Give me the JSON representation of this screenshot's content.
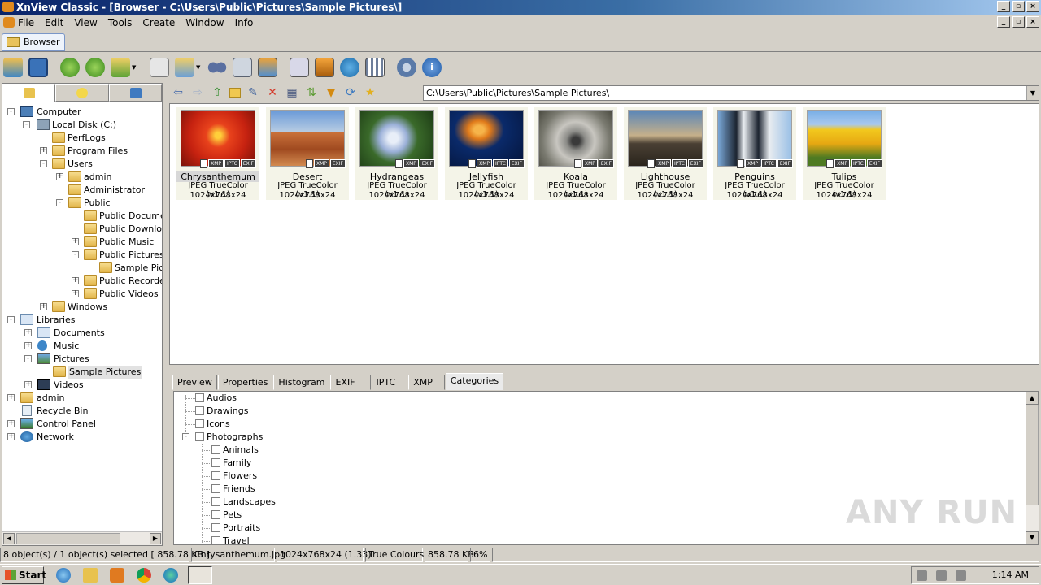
{
  "window": {
    "title": "XnView Classic - [Browser - C:\\Users\\Public\\Pictures\\Sample Pictures\\]"
  },
  "menu": [
    "File",
    "Edit",
    "View",
    "Tools",
    "Create",
    "Window",
    "Info"
  ],
  "doc_tab": "Browser",
  "address": "C:\\Users\\Public\\Pictures\\Sample Pictures\\",
  "tree": [
    {
      "label": "Computer",
      "icon": "computer-icon"
    },
    {
      "label": "Local Disk (C:)",
      "icon": "drive-icon"
    },
    {
      "label": "PerfLogs",
      "icon": "folder-icon"
    },
    {
      "label": "Program Files",
      "icon": "folder-icon"
    },
    {
      "label": "Users",
      "icon": "folder-icon"
    },
    {
      "label": "admin",
      "icon": "folder-icon"
    },
    {
      "label": "Administrator",
      "icon": "folder-icon"
    },
    {
      "label": "Public",
      "icon": "folder-icon"
    },
    {
      "label": "Public Documen",
      "icon": "folder-icon"
    },
    {
      "label": "Public Downloac",
      "icon": "folder-icon"
    },
    {
      "label": "Public Music",
      "icon": "folder-icon"
    },
    {
      "label": "Public Pictures",
      "icon": "folder-icon"
    },
    {
      "label": "Sample Pictu",
      "icon": "folder-icon"
    },
    {
      "label": "Public Recorded",
      "icon": "folder-icon"
    },
    {
      "label": "Public Videos",
      "icon": "folder-icon"
    },
    {
      "label": "Windows",
      "icon": "folder-icon"
    },
    {
      "label": "Libraries",
      "icon": "libraries-icon"
    },
    {
      "label": "Documents",
      "icon": "documents-icon"
    },
    {
      "label": "Music",
      "icon": "music-icon"
    },
    {
      "label": "Pictures",
      "icon": "pictures-icon"
    },
    {
      "label": "Sample Pictures",
      "icon": "folder-icon"
    },
    {
      "label": "Videos",
      "icon": "videos-icon"
    },
    {
      "label": "admin",
      "icon": "user-folder-icon"
    },
    {
      "label": "Recycle Bin",
      "icon": "recycle-bin-icon"
    },
    {
      "label": "Control Panel",
      "icon": "control-panel-icon"
    },
    {
      "label": "Network",
      "icon": "network-icon"
    }
  ],
  "thumbnails": [
    {
      "name": "Chrysanthemum",
      "format": "JPEG TrueColor (v1.1)",
      "dims": "1024x768x24",
      "badges": [
        "XMP",
        "IPTC",
        "EXIF"
      ]
    },
    {
      "name": "Desert",
      "format": "JPEG TrueColor (v1.1)",
      "dims": "1024x768x24",
      "badges": [
        "XMP",
        "EXIF"
      ]
    },
    {
      "name": "Hydrangeas",
      "format": "JPEG TrueColor (v1.1)",
      "dims": "1024x768x24",
      "badges": [
        "XMP",
        "EXIF"
      ]
    },
    {
      "name": "Jellyfish",
      "format": "JPEG TrueColor (v1.1)",
      "dims": "1024x768x24",
      "badges": [
        "XMP",
        "IPTC",
        "EXIF"
      ]
    },
    {
      "name": "Koala",
      "format": "JPEG TrueColor (v1.1)",
      "dims": "1024x768x24",
      "badges": [
        "XMP",
        "EXIF"
      ]
    },
    {
      "name": "Lighthouse",
      "format": "JPEG TrueColor (v1.1)",
      "dims": "1024x768x24",
      "badges": [
        "XMP",
        "IPTC",
        "EXIF"
      ]
    },
    {
      "name": "Penguins",
      "format": "JPEG TrueColor (v1.1)",
      "dims": "1024x768x24",
      "badges": [
        "XMP",
        "IPTC",
        "EXIF"
      ]
    },
    {
      "name": "Tulips",
      "format": "JPEG TrueColor (v1.1)",
      "dims": "1024x768x24",
      "badges": [
        "XMP",
        "IPTC",
        "EXIF"
      ]
    }
  ],
  "info_tabs": [
    "Preview",
    "Properties",
    "Histogram",
    "EXIF",
    "IPTC",
    "XMP",
    "Categories"
  ],
  "categories": [
    "Audios",
    "Drawings",
    "Icons",
    "Photographs",
    "Animals",
    "Family",
    "Flowers",
    "Friends",
    "Landscapes",
    "Pets",
    "Portraits",
    "Travel"
  ],
  "status": {
    "objects": "8 object(s) / 1 object(s) selected  [ 858.78 KB ]",
    "file": "Chrysanthemum.jpg",
    "dims": "1024x768x24 (1.33)",
    "colors": "True Colours",
    "size": "858.78 KB",
    "zoom": "6%"
  },
  "taskbar": {
    "start": "Start",
    "clock": "1:14 AM"
  },
  "watermark": "ANY RUN"
}
